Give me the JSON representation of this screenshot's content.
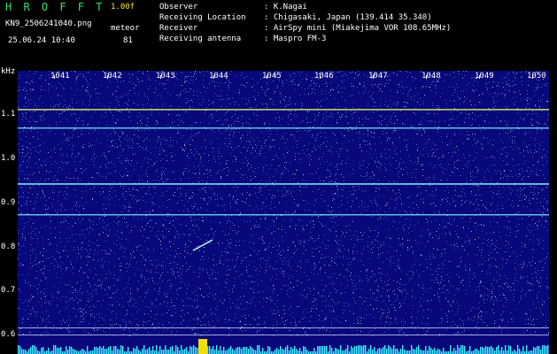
{
  "header": {
    "app_title": "H R O F F T",
    "version": "1.00f",
    "filename": "KN9_2506241040.png",
    "meteor_label": "meteor",
    "timestamp": "25.06.24 10:40",
    "count": "81"
  },
  "meta": [
    {
      "label": "Observer",
      "value": ": K.Nagai"
    },
    {
      "label": "Receiving Location",
      "value": ": Chigasaki, Japan (139.414 35.340)"
    },
    {
      "label": "Receiver",
      "value": ": AirSpy mini (Miakejima VOR 108.65MHz)"
    },
    {
      "label": "Receiving antenna",
      "value": ": Maspro FM-3"
    }
  ],
  "axis": {
    "y_unit": "kHz",
    "y_ticks": [
      "1.1",
      "1.0",
      "0.9",
      "0.8",
      "0.7",
      "0.6"
    ],
    "x_ticks": [
      "1041",
      "1042",
      "1043",
      "1044",
      "1045",
      "1046",
      "1047",
      "1048",
      "1049",
      "1050"
    ]
  },
  "colors": {
    "background": "#08087a",
    "trace": "#7ee8ff",
    "noise": "#7fb8ff",
    "bottom_bar": "#3cf0ff",
    "marker": "#f0e000"
  }
}
